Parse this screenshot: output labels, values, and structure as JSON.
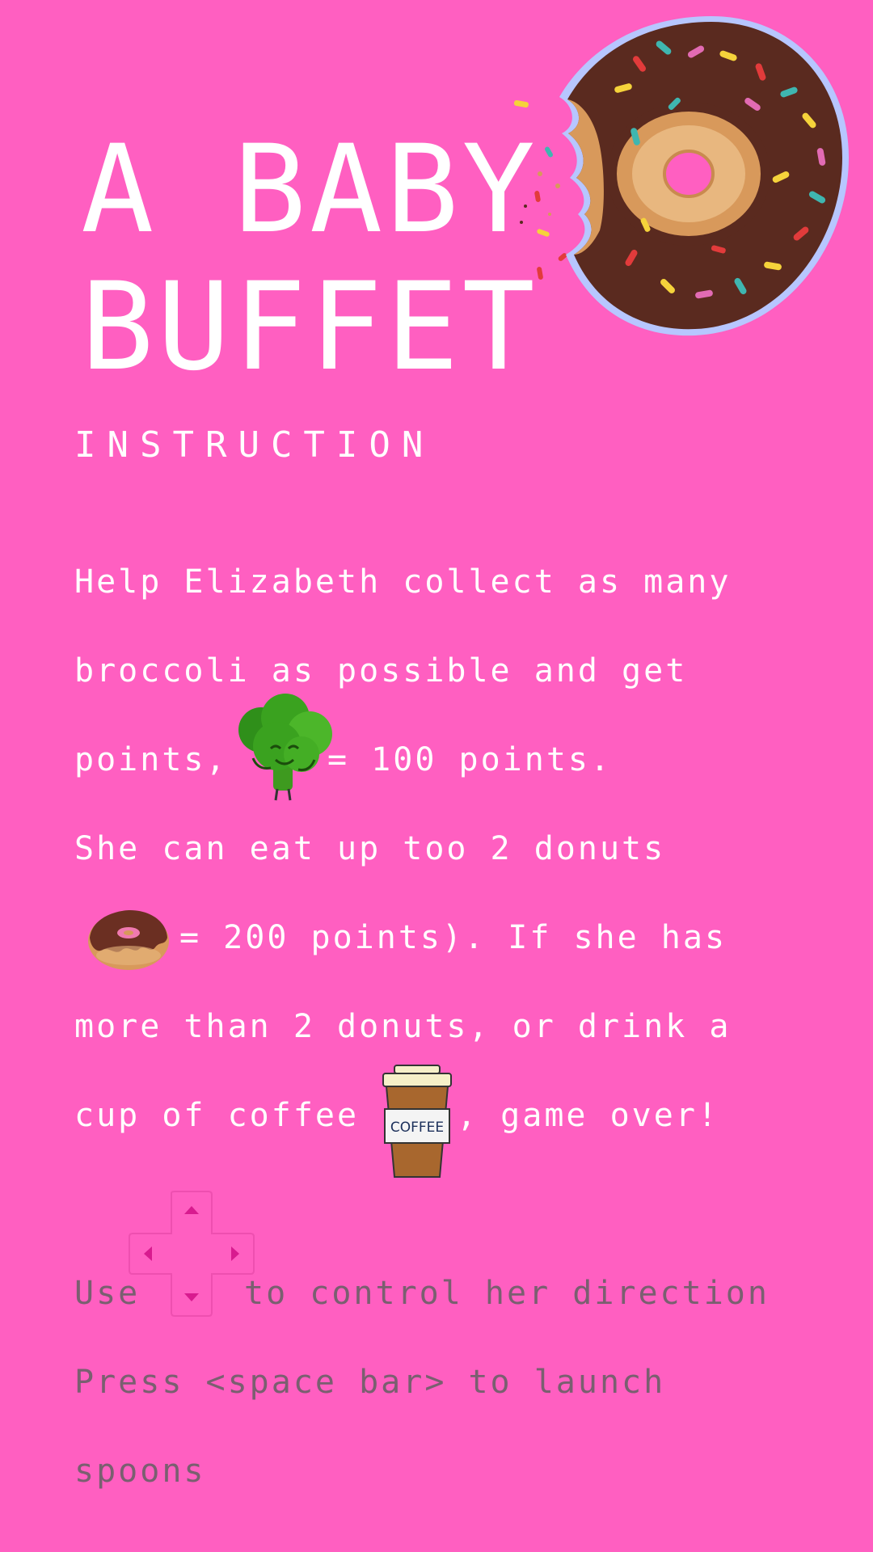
{
  "title": {
    "line1": "A BABY",
    "line2": "BUFFET"
  },
  "instruction_heading": "INSTRUCTION",
  "instructions": {
    "line1": "Help Elizabeth collect as many",
    "line2": "broccoli as possible and get",
    "line3_a": "points,",
    "line3_b": "= 100 points.",
    "line4": "She can eat up too 2 donuts",
    "line5": "= 200 points). If she has",
    "line6": "more than 2 donuts, or drink a",
    "line7_a": "cup of coffee",
    "line7_b": ", game over!"
  },
  "controls": {
    "line1_a": "Use",
    "line1_b": "to control her direction",
    "line2": "Press <space bar> to launch",
    "line3": "spoons"
  },
  "coffee_cup_label": "COFFEE",
  "icons": {
    "donut": "donut-icon",
    "broccoli": "broccoli-icon",
    "coffee": "coffee-cup-icon",
    "dpad": "arrow-keys-icon"
  },
  "colors": {
    "background": "#ff5fc1",
    "text": "#ffffff",
    "muted_text": "#7a5f70",
    "chocolate": "#5a2a1f",
    "dough": "#d8995b"
  }
}
